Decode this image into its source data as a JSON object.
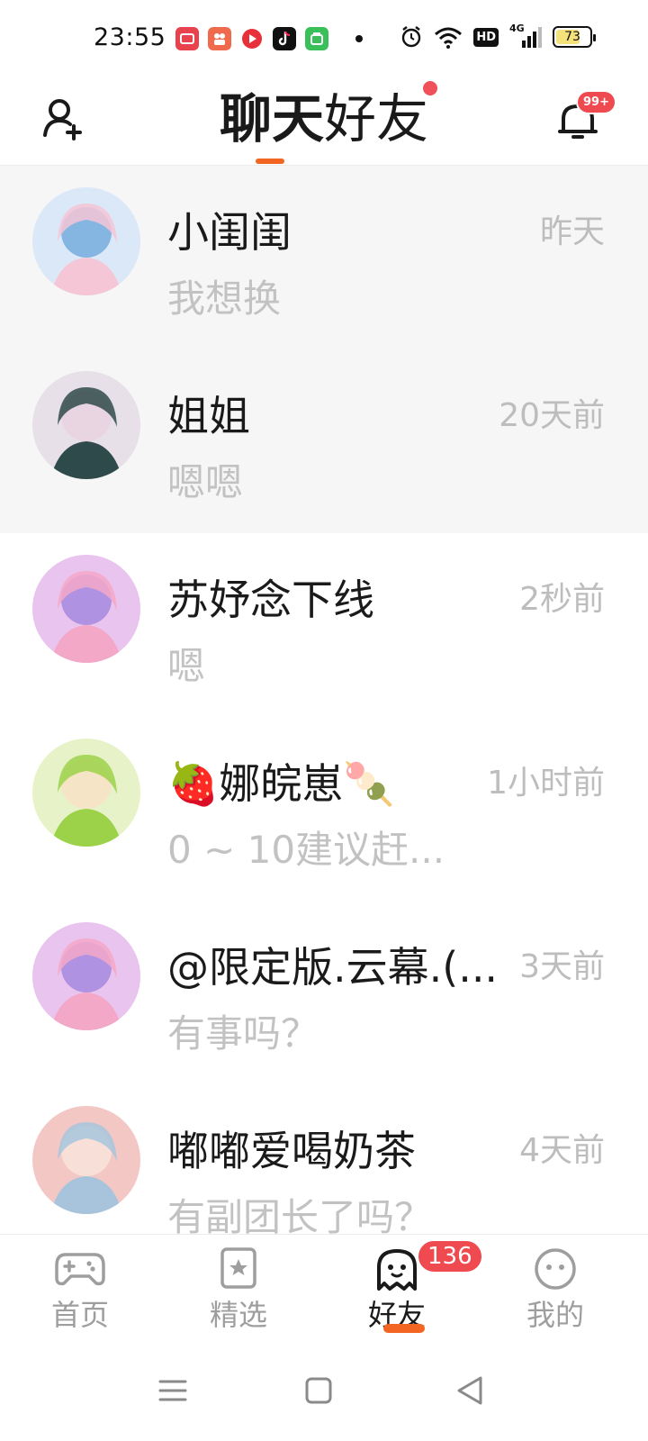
{
  "status_bar": {
    "time": "23:55",
    "battery": "73",
    "battery_level": 0.73,
    "network_label": "4G",
    "hd_label": "HD"
  },
  "header": {
    "tab_chat": "聊天",
    "tab_friends": "好友",
    "notification_badge": "99+"
  },
  "chats": [
    {
      "name": "小闺闺",
      "time": "昨天",
      "preview": "我想换",
      "pinned": true,
      "avatar_colors": [
        "#dbe8f8",
        "#f4c6d6",
        "#7ab0de"
      ]
    },
    {
      "name": "姐姐",
      "time": "20天前",
      "preview": "嗯嗯",
      "pinned": true,
      "avatar_colors": [
        "#e7e0e8",
        "#2f4a4a",
        "#e9d4e1"
      ]
    },
    {
      "name": "苏妤念下线",
      "time": "2秒前",
      "preview": "嗯",
      "pinned": false,
      "avatar_colors": [
        "#e9c4ee",
        "#f4a8c8",
        "#a88de0"
      ]
    },
    {
      "name": "🍓娜皖崽🍡",
      "time": "1小时前",
      "preview": "0 ~ 10建议赶...",
      "pinned": false,
      "avatar_colors": [
        "#e8f2c8",
        "#9cd24a",
        "#f7e2c7"
      ]
    },
    {
      "name": "@限定版.云幕.(...",
      "time": "3天前",
      "preview": "有事吗？",
      "pinned": false,
      "avatar_colors": [
        "#e9c4ee",
        "#f4a8c8",
        "#a88de0"
      ]
    },
    {
      "name": "嘟嘟爱喝奶茶",
      "time": "4天前",
      "preview": "有副团长了吗？",
      "pinned": false,
      "avatar_colors": [
        "#f3c8c4",
        "#a7c4dc",
        "#f8e2dc"
      ]
    }
  ],
  "bottom_nav": {
    "items": [
      {
        "label": "首页",
        "icon": "gamepad-icon"
      },
      {
        "label": "精选",
        "icon": "star-card-icon"
      },
      {
        "label": "好友",
        "icon": "ghost-icon"
      },
      {
        "label": "我的",
        "icon": "face-icon"
      }
    ],
    "friends_badge": "136"
  },
  "colors": {
    "accent": "#f26522",
    "badge": "#ef4a4f",
    "muted_text": "#bdbdbd",
    "pinned_bg": "#f6f6f6"
  }
}
